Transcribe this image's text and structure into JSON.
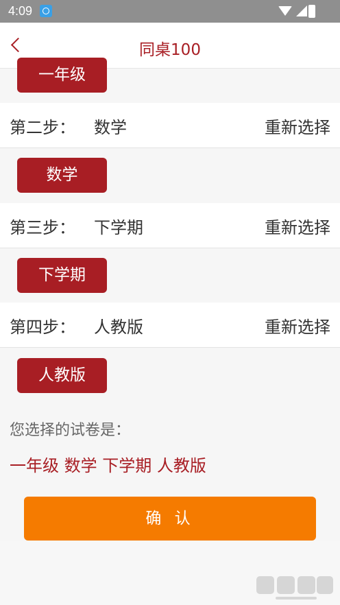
{
  "status_bar": {
    "time": "4:09"
  },
  "header": {
    "title": "同桌100"
  },
  "grade_chip": "一年级",
  "steps": [
    {
      "label": "第二步：",
      "value": "数学",
      "action": "重新选择",
      "chip": "数学"
    },
    {
      "label": "第三步：",
      "value": "下学期",
      "action": "重新选择",
      "chip": "下学期"
    },
    {
      "label": "第四步：",
      "value": "人教版",
      "action": "重新选择",
      "chip": "人教版"
    }
  ],
  "summary": {
    "label": "您选择的试卷是：",
    "value": "一年级 数学 下学期 人教版"
  },
  "confirm_label": "确 认",
  "colors": {
    "brand_red": "#a81e24",
    "confirm_orange": "#f57b00"
  },
  "icons": [
    "back-icon",
    "wifi-icon",
    "signal-icon",
    "battery-icon",
    "app-notification-icon"
  ]
}
